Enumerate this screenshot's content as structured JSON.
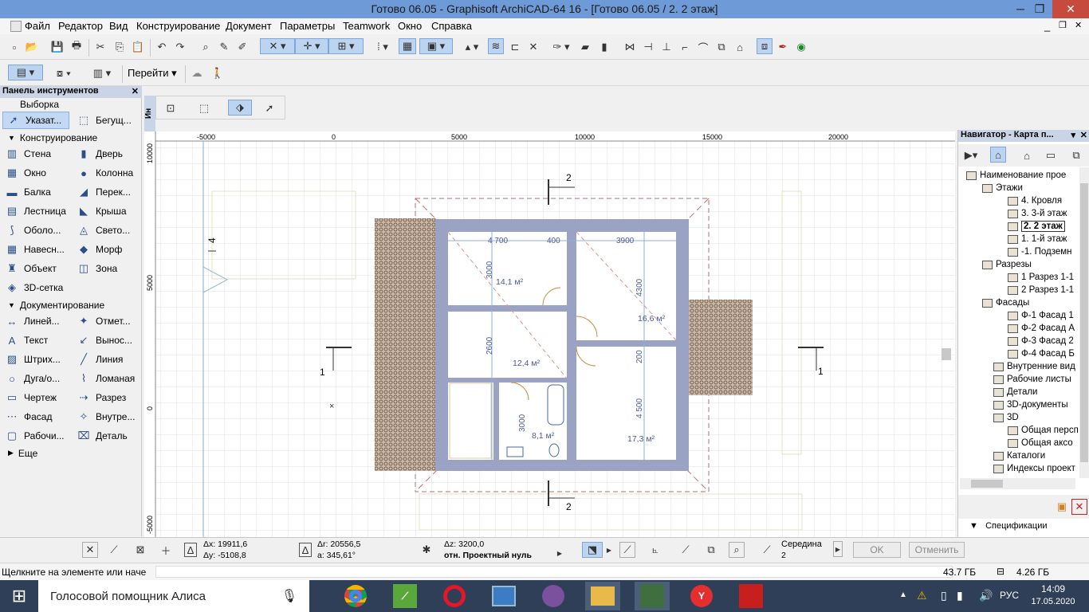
{
  "window": {
    "title": "Готово 06.05 - Graphisoft ArchiCAD-64 16 - [Готово 06.05 / 2. 2 этаж]",
    "min": "─",
    "restore": "❐",
    "close": "✕"
  },
  "menubar": {
    "items": [
      "Файл",
      "Редактор",
      "Вид",
      "Конструирование",
      "Документ",
      "Параметры",
      "Teamwork",
      "Окно",
      "Справка"
    ],
    "ctrl_min": "_",
    "ctrl_restore": "❐",
    "ctrl_close": "✕"
  },
  "toolbar2": {
    "goto_label": "Перейти"
  },
  "toolbox": {
    "title": "Панель инструментов",
    "selection_section": "Выборка",
    "pointer": "Указат...",
    "marquee": "Бегущ...",
    "construct_section": "Конструирование",
    "construct_tools": [
      [
        "Стена",
        "Дверь"
      ],
      [
        "Окно",
        "Колонна"
      ],
      [
        "Балка",
        "Перек..."
      ],
      [
        "Лестница",
        "Крыша"
      ],
      [
        "Оболо...",
        "Свето..."
      ],
      [
        "Навесн...",
        "Морф"
      ],
      [
        "Объект",
        "Зона"
      ],
      [
        "3D-сетка",
        ""
      ]
    ],
    "document_section": "Документирование",
    "document_tools": [
      [
        "Линей...",
        "Отмет..."
      ],
      [
        "Текст",
        "Вынос..."
      ],
      [
        "Штрих...",
        "Линия"
      ],
      [
        "Дуга/о...",
        "Ломаная"
      ],
      [
        "Чертеж",
        "Разрез"
      ],
      [
        "Фасад",
        "Внутре..."
      ],
      [
        "Рабочи...",
        "Деталь"
      ]
    ],
    "more": "Еще"
  },
  "infobox": {
    "side_label": "Ин"
  },
  "ruler": {
    "h_ticks": [
      "-5000",
      "0",
      "5000",
      "10000",
      "15000",
      "20000"
    ],
    "v_ticks": [
      "10000",
      "5000",
      "0",
      "-5000"
    ]
  },
  "plan": {
    "dims_top": [
      "4 700",
      "400",
      "3900"
    ],
    "dims_left": [
      "3000",
      "2600",
      "3000"
    ],
    "dims_right": [
      "4300",
      "200",
      "4 500"
    ],
    "rooms": [
      "14,1 м²",
      "16,6 м²",
      "12,4 м²",
      "8,1 м²",
      "17,3 м²"
    ],
    "section_marks": [
      "2",
      "2",
      "1",
      "1"
    ],
    "axis_label": "4"
  },
  "navigator": {
    "title": "Навигатор - Карта п...",
    "root": "Наименование прое",
    "stories_label": "Этажи",
    "stories": [
      "4. Кровля",
      "3. 3-й этаж",
      "2. 2 этаж",
      "1. 1-й этаж",
      "-1. Подземн"
    ],
    "sections_label": "Разрезы",
    "sections": [
      "1 Разрез 1-1",
      "2 Разрез 1-1"
    ],
    "elevations_label": "Фасады",
    "elevations": [
      "Ф-1 Фасад 1",
      "Ф-2 Фасад А",
      "Ф-3 Фасад 2",
      "Ф-4 Фасад Б"
    ],
    "others": [
      "Внутренние вид",
      "Рабочие листы",
      "Детали",
      "3D-документы"
    ],
    "threed_label": "3D",
    "threed": [
      "Общая персп",
      "Общая аксо"
    ],
    "tail": [
      "Каталоги",
      "Индексы проект"
    ],
    "specs": "Спецификации"
  },
  "coords": {
    "dx": "Δx: 19911,6",
    "dy": "Δy: -5108,8",
    "dr": "Δr: 20556,5",
    "da": "a: 345,61°",
    "dz": "Δz: 3200,0",
    "ref": "отн. Проектный нуль",
    "snap": "Середина",
    "snap_n": "2"
  },
  "buttons": {
    "ok": "OK",
    "cancel": "Отменить"
  },
  "status": {
    "hint": "Щелкните на элементе или наче",
    "disk1": "43.7 ГБ",
    "disk2": "4.26 ГБ"
  },
  "taskbar": {
    "search": "Голосовой помощник Алиса",
    "lang": "РУС",
    "time": "14:09",
    "date": "17.05.2020"
  }
}
